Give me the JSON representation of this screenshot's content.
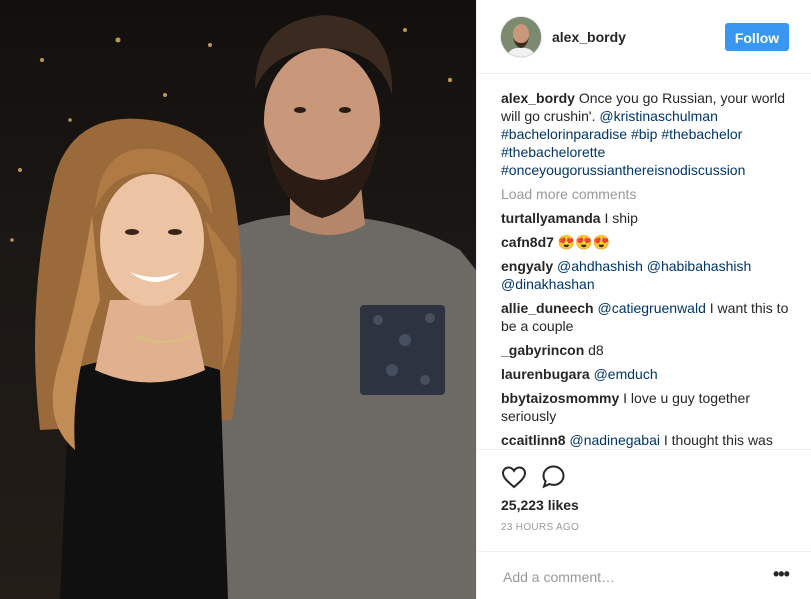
{
  "post": {
    "username": "alex_bordy",
    "follow_label": "Follow",
    "caption": {
      "user": "alex_bordy",
      "text": "Once you go Russian, your world will go crushin'.",
      "tags": [
        "@kristinaschulman",
        "#bachelorinparadise",
        "#bip",
        "#thebachelor",
        "#thebachelorette",
        "#onceyougorussianthereisnodiscussion"
      ]
    },
    "load_more_label": "Load more comments",
    "comments": [
      {
        "user": "turtallyamanda",
        "text": "I ship"
      },
      {
        "user": "cafn8d7",
        "text": "😍😍😍"
      },
      {
        "user": "engyaly",
        "mention": "@ahdhashish @habibahashish @dinakhashan",
        "text": ""
      },
      {
        "user": "allie_duneech",
        "mention": "@catiegruenwald",
        "text": "I want this to be a couple"
      },
      {
        "user": "_gabyrincon",
        "text": "d8"
      },
      {
        "user": "laurenbugara",
        "mention": "@emduch",
        "text": ""
      },
      {
        "user": "bbytaizosmommy",
        "text": "I love u guy together seriously"
      },
      {
        "user": "ccaitlinn8",
        "mention": "@nadinegabai",
        "text": "I thought this was"
      }
    ],
    "likes": "25,223 likes",
    "time": "23 HOURS AGO",
    "add_comment_placeholder": "Add a comment…",
    "more_glyph": "•••",
    "icons": {
      "like": "heart-icon",
      "comment": "comment-icon",
      "more": "more-options-icon"
    },
    "colors": {
      "follow_bg": "#3897f0",
      "hashtag": "#003569",
      "muted": "#999999",
      "border": "#efefef"
    }
  }
}
